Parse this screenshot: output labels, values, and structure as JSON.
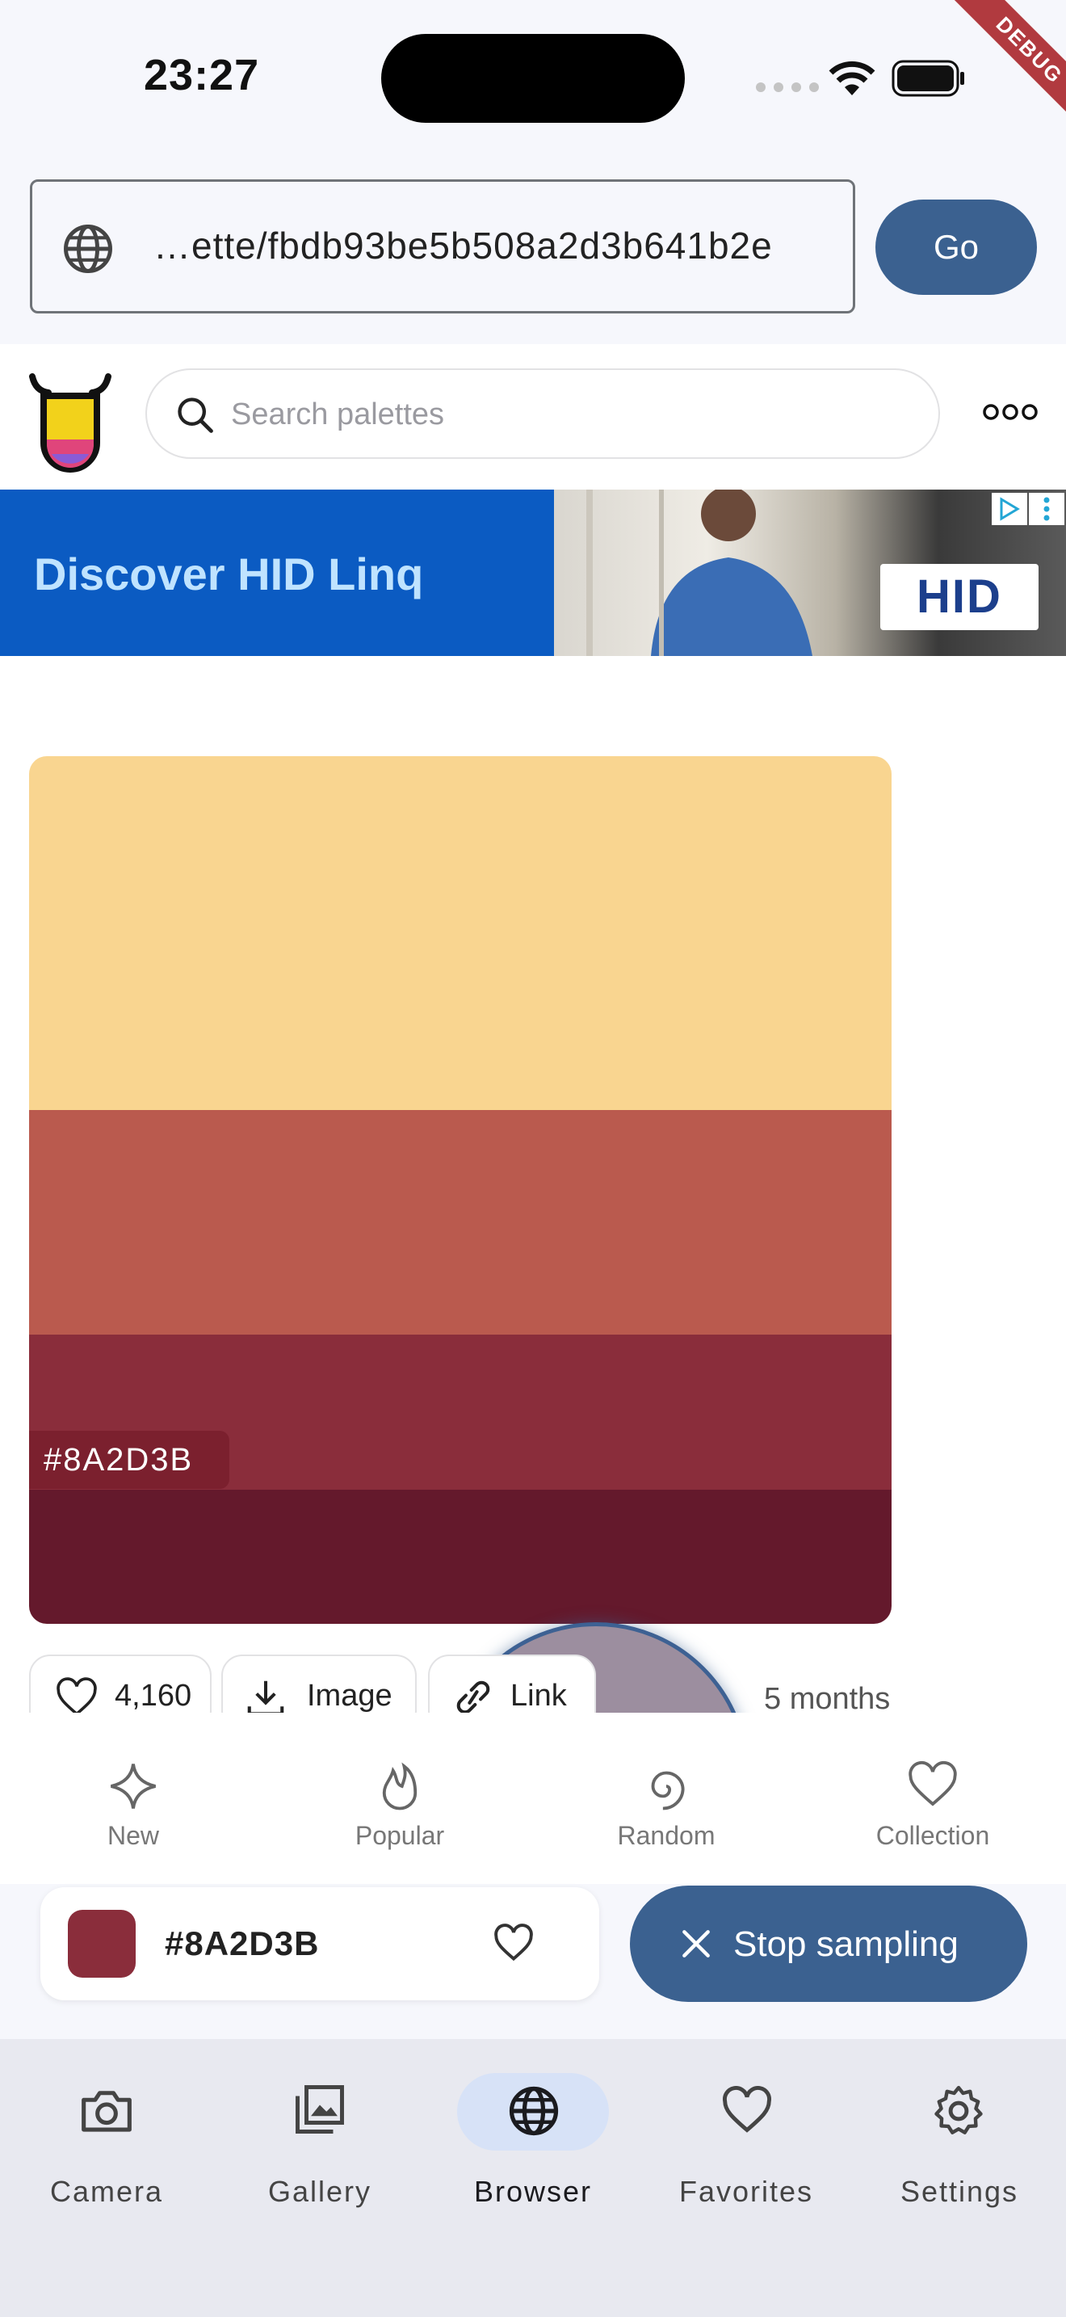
{
  "status_bar": {
    "time": "23:27",
    "debug_label": "DEBUG"
  },
  "url_bar": {
    "url": "…ette/fbdb93be5b508a2d3b641b2e",
    "go_label": "Go"
  },
  "site": {
    "search_placeholder": "Search palettes",
    "ad": {
      "headline": "Discover HID Linq",
      "brand": "HID"
    },
    "palette": {
      "colors": [
        "#f9d590",
        "#ba5a4e",
        "#8a2d3b",
        "#64192c"
      ],
      "hex_label": "#8A2D3B"
    },
    "actions": {
      "likes": "4,160",
      "image_label": "Image",
      "link_label": "Link",
      "age": "5 months"
    },
    "tabs": [
      "New",
      "Popular",
      "Random",
      "Collection"
    ]
  },
  "sampler": {
    "color_hex": "#8A2D3B",
    "color": "#8a2d3b",
    "stop_label": "Stop sampling"
  },
  "nav": {
    "items": [
      "Camera",
      "Gallery",
      "Browser",
      "Favorites",
      "Settings"
    ],
    "active": "Browser"
  },
  "colors": {
    "accent": "#3b6190",
    "active_pill": "#d7e2f7"
  }
}
